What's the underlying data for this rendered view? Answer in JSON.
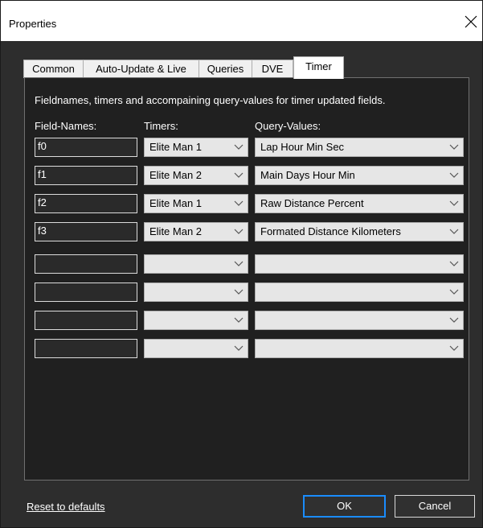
{
  "window": {
    "title": "Properties"
  },
  "tabs": [
    {
      "label": "Common",
      "active": false
    },
    {
      "label": "Auto-Update & Live",
      "active": false
    },
    {
      "label": "Queries",
      "active": false
    },
    {
      "label": "DVE",
      "active": false
    },
    {
      "label": "Timer",
      "active": true
    }
  ],
  "panel": {
    "description": "Fieldnames, timers and accompaining query-values for timer updated fields.",
    "headers": {
      "field_names": "Field-Names:",
      "timers": "Timers:",
      "query_values": "Query-Values:"
    },
    "rows": [
      {
        "field": "f0",
        "timer": "Elite Man 1",
        "query": "Lap Hour Min Sec"
      },
      {
        "field": "f1",
        "timer": "Elite Man 2",
        "query": "Main Days Hour Min"
      },
      {
        "field": "f2",
        "timer": "Elite Man 1",
        "query": "Raw Distance Percent"
      },
      {
        "field": "f3",
        "timer": "Elite Man 2",
        "query": "Formated Distance Kilometers"
      },
      {
        "field": "",
        "timer": "",
        "query": ""
      },
      {
        "field": "",
        "timer": "",
        "query": ""
      },
      {
        "field": "",
        "timer": "",
        "query": ""
      },
      {
        "field": "",
        "timer": "",
        "query": ""
      }
    ]
  },
  "footer": {
    "reset_label": "Reset to defaults",
    "ok_label": "OK",
    "cancel_label": "Cancel"
  },
  "icons": {
    "close": "close-icon",
    "dropdown": "chevron-down-icon"
  },
  "colors": {
    "focus_border": "#1a8cff",
    "panel_bg": "#202020",
    "dialog_bg": "#2d2d2d"
  }
}
